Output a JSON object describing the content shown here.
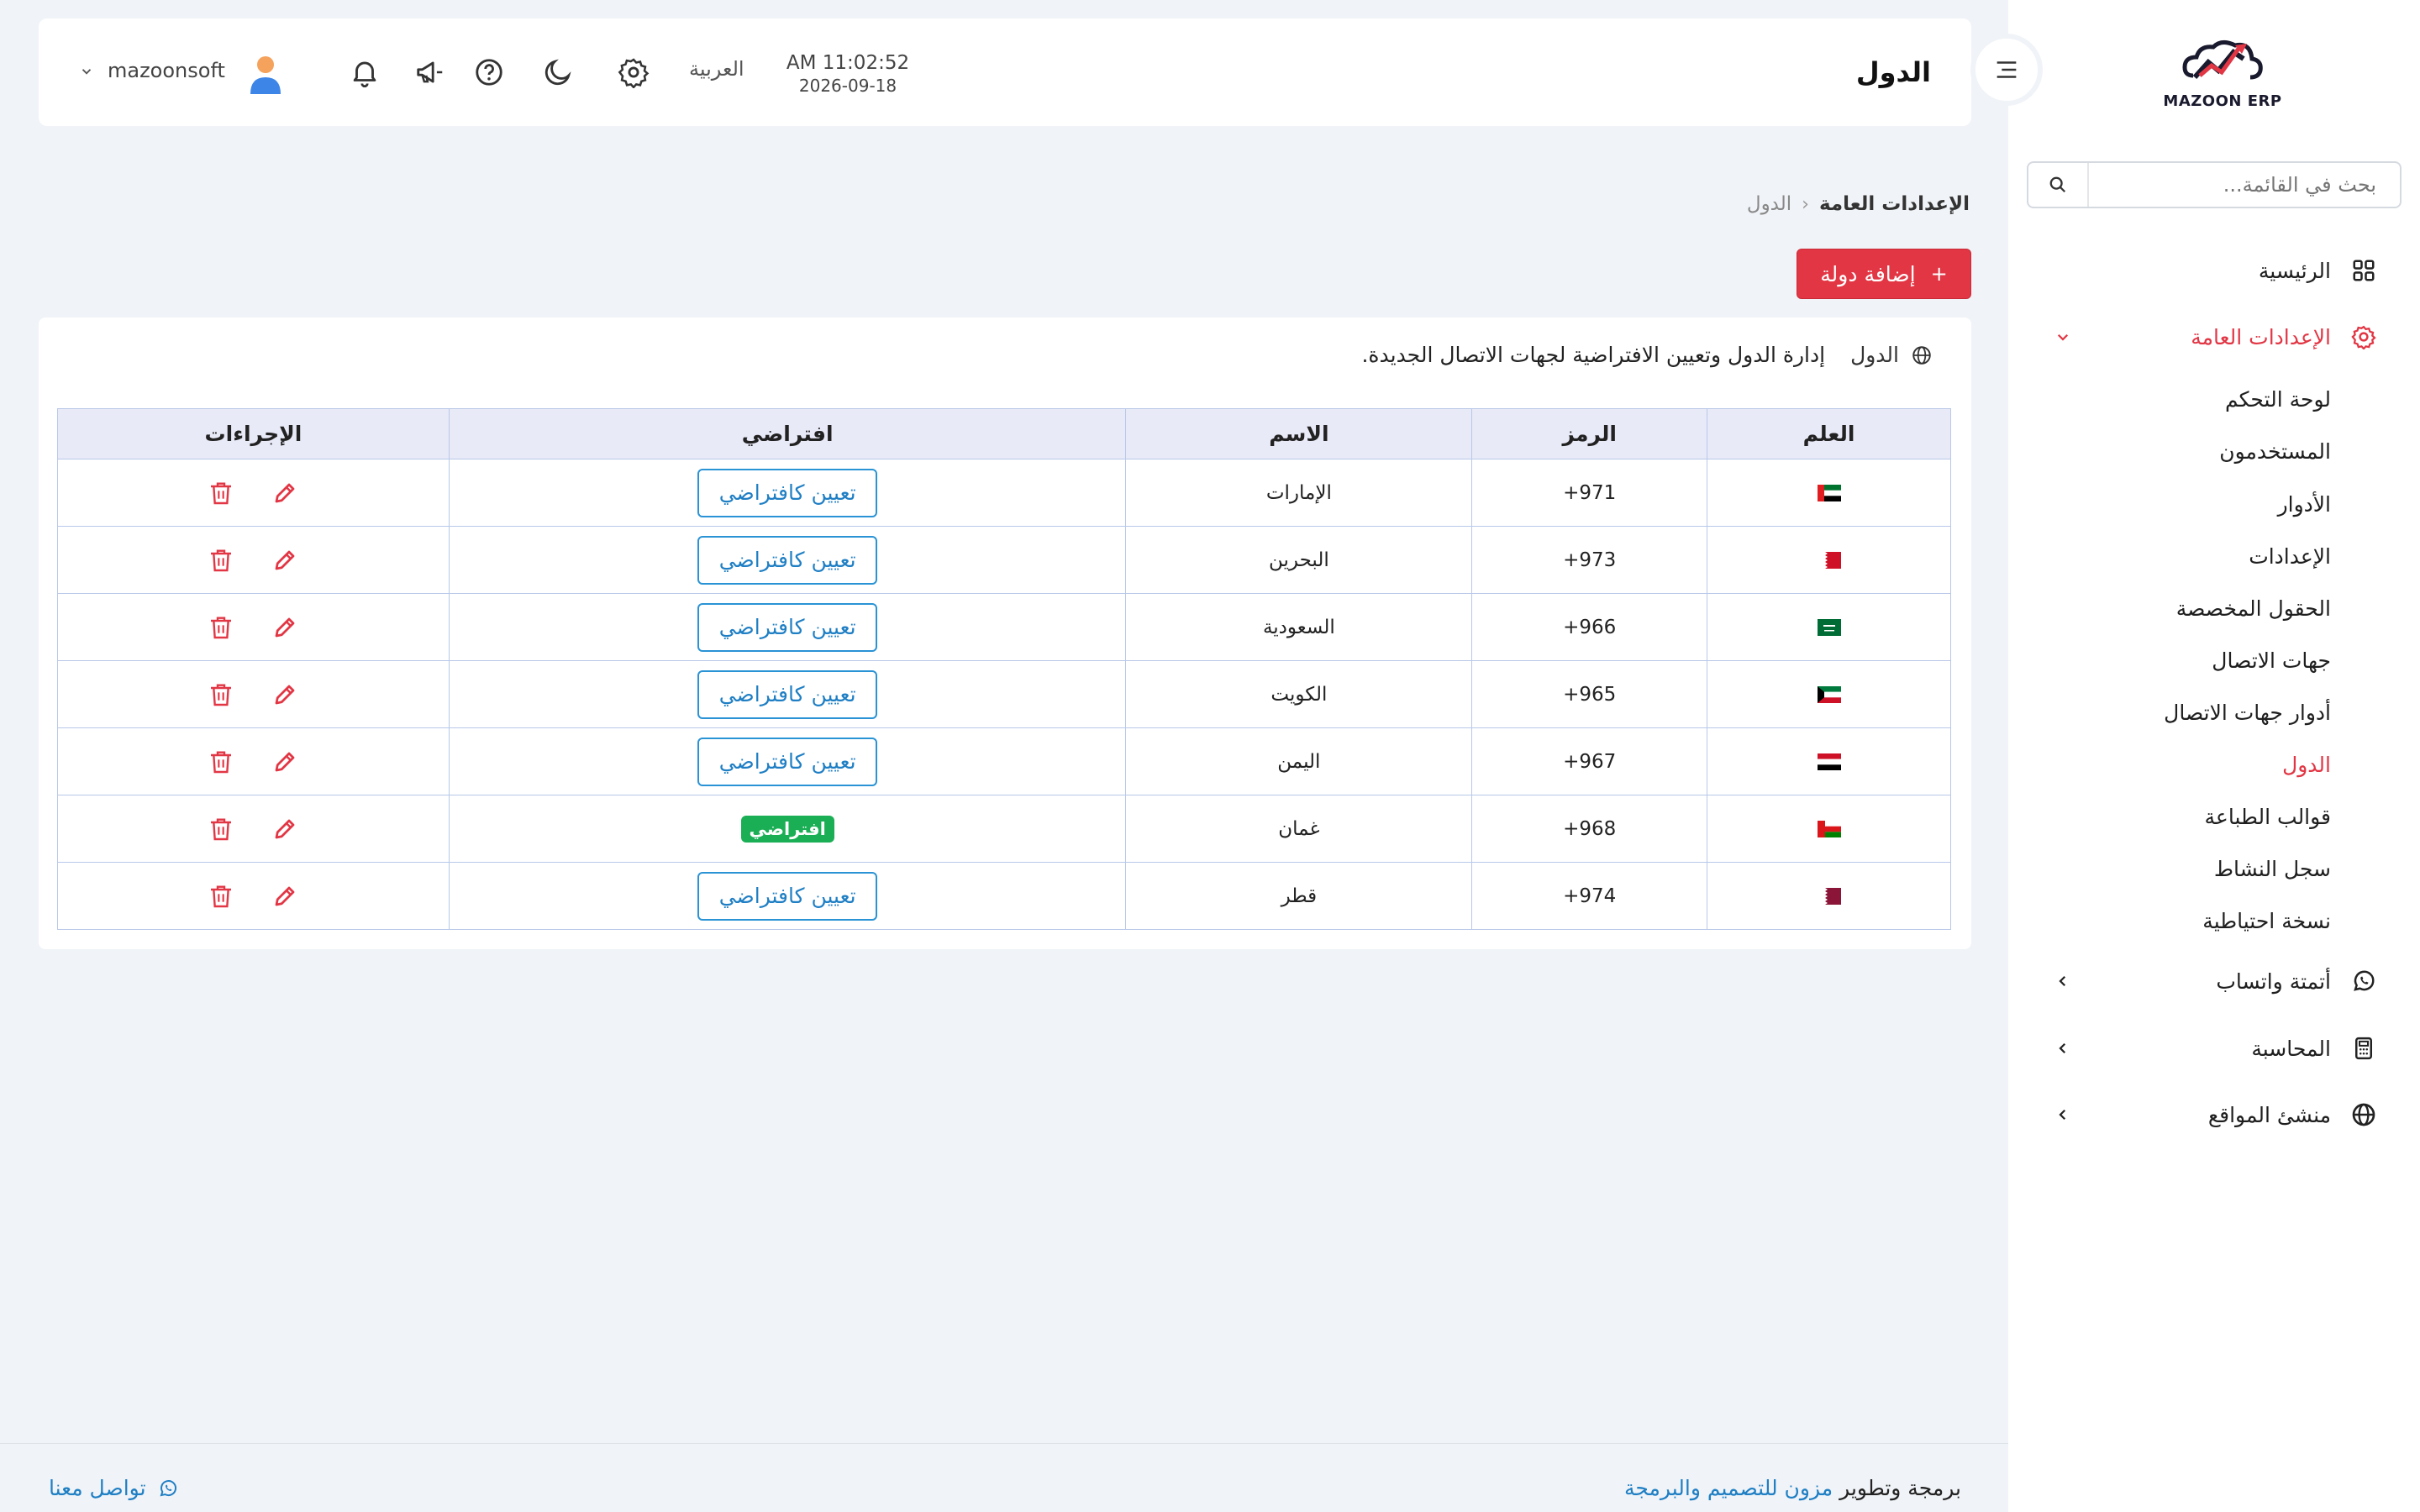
{
  "app": {
    "brand": "MAZOON ERP",
    "brand_accent": "#e23644"
  },
  "sidebar": {
    "search_placeholder": "بحث في القائمة...",
    "items": [
      {
        "label": "الرئيسية",
        "icon": "dashboard-grid-icon"
      },
      {
        "label": "الإعدادات العامة",
        "icon": "gear-icon",
        "expanded": true
      },
      {
        "label": "أتمتة واتساب",
        "icon": "whatsapp-icon"
      },
      {
        "label": "المحاسبة",
        "icon": "calculator-icon"
      },
      {
        "label": "منشئ المواقع",
        "icon": "globe-icon"
      }
    ],
    "sub_items": [
      "لوحة التحكم",
      "المستخدمون",
      "الأدوار",
      "الإعدادات",
      "الحقول المخصصة",
      "جهات الاتصال",
      "أدوار جهات الاتصال",
      "الدول",
      "قوالب الطباعة",
      "سجل النشاط",
      "نسخة احتياطية"
    ]
  },
  "header": {
    "title": "الدول",
    "time": "AM 11:02:52",
    "date": "2026-09-18",
    "language": "العربية",
    "username": "mazoonsoft"
  },
  "breadcrumb": {
    "parent": "الإعدادات العامة",
    "current": "الدول"
  },
  "add_button_label": "إضافة دولة",
  "card": {
    "title": "الدول",
    "description": "إدارة الدول وتعيين الافتراضية لجهات الاتصال الجديدة."
  },
  "table": {
    "headers": [
      "العلم",
      "الرمز",
      "الاسم",
      "افتراضي",
      "الإجراءات"
    ],
    "set_default_label": "تعيين كافتراضي",
    "default_badge": "افتراضي",
    "rows": [
      {
        "flag": "uae",
        "code": "+971",
        "name": "الإمارات",
        "is_default": false
      },
      {
        "flag": "bahrain",
        "code": "+973",
        "name": "البحرين",
        "is_default": false
      },
      {
        "flag": "saudi",
        "code": "+966",
        "name": "السعودية",
        "is_default": false
      },
      {
        "flag": "kuwait",
        "code": "+965",
        "name": "الكويت",
        "is_default": false
      },
      {
        "flag": "yemen",
        "code": "+967",
        "name": "اليمن",
        "is_default": false
      },
      {
        "flag": "oman",
        "code": "+968",
        "name": "غمان",
        "is_default": true
      },
      {
        "flag": "qatar",
        "code": "+974",
        "name": "قطر",
        "is_default": false
      }
    ]
  },
  "footer": {
    "contact": "تواصل معنا",
    "credit_prefix": "برمجة وتطوير",
    "credit_link": "مزون للتصميم والبرمجة"
  }
}
